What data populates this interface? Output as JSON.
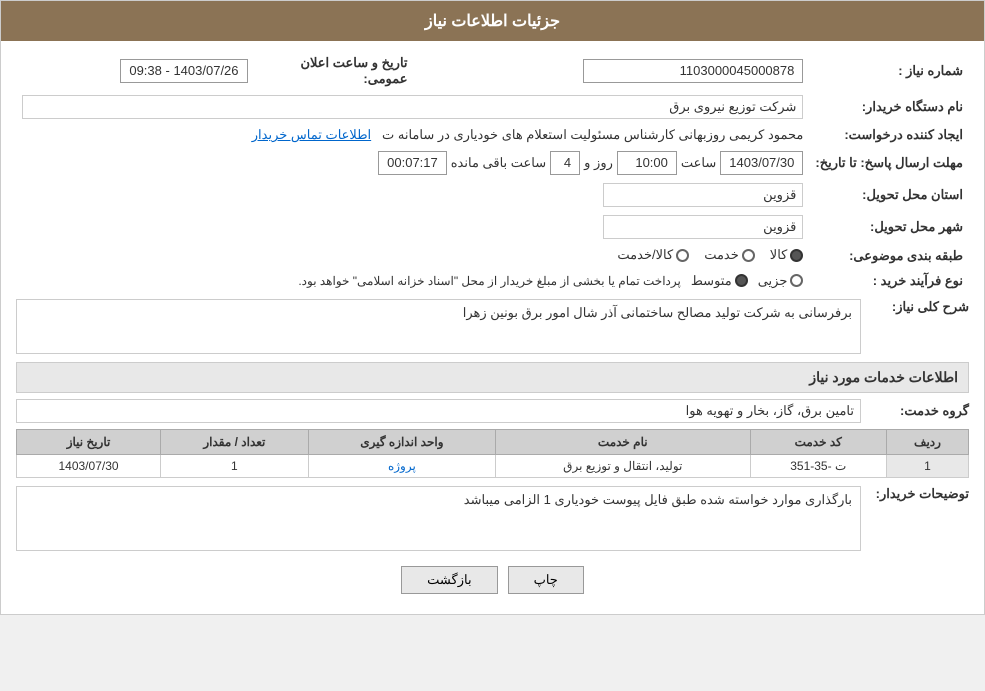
{
  "header": {
    "title": "جزئیات اطلاعات نیاز"
  },
  "fields": {
    "need_number_label": "شماره نیاز :",
    "need_number_value": "1103000045000878",
    "buyer_org_label": "نام دستگاه خریدار:",
    "buyer_org_value": "شرکت توزیع نیروی برق",
    "creator_label": "ایجاد کننده درخواست:",
    "creator_value": "محمود کریمی روزبهانی کارشناس  مسئولیت استعلام های خودیاری در سامانه ت",
    "creator_link": "اطلاعات تماس خریدار",
    "deadline_label": "مهلت ارسال پاسخ: تا تاریخ:",
    "deadline_date": "1403/07/30",
    "deadline_time_label": "ساعت",
    "deadline_time": "10:00",
    "deadline_day_label": "روز و",
    "deadline_days": "4",
    "deadline_remaining_label": "ساعت باقی مانده",
    "deadline_remaining": "00:07:17",
    "announce_label": "تاریخ و ساعت اعلان عمومی:",
    "announce_value": "1403/07/26 - 09:38",
    "province_label": "استان محل تحویل:",
    "province_value": "قزوین",
    "city_label": "شهر محل تحویل:",
    "city_value": "قزوین",
    "category_label": "طبقه بندی موضوعی:",
    "category_options": [
      "کالا",
      "خدمت",
      "کالا/خدمت"
    ],
    "category_selected": "کالا",
    "procurement_label": "نوع فرآیند خرید :",
    "procurement_options": [
      "جزیی",
      "متوسط"
    ],
    "procurement_selected": "متوسط",
    "procurement_note": "پرداخت تمام یا بخشی از مبلغ خریدار از محل \"اسناد خزانه اسلامی\" خواهد بود.",
    "need_desc_label": "شرح کلی نیاز:",
    "need_desc_value": "برفرسانی به شرکت تولید مصالح ساختمانی آذر شال امور برق بونین زهرا",
    "services_section_label": "اطلاعات خدمات مورد نیاز",
    "service_group_label": "گروه خدمت:",
    "service_group_value": "تامین برق، گاز، بخار و تهویه هوا",
    "table_headers": [
      "ردیف",
      "کد خدمت",
      "نام خدمت",
      "واحد اندازه گیری",
      "تعداد / مقدار",
      "تاریخ نیاز"
    ],
    "table_rows": [
      {
        "row": "1",
        "code": "ت -35-351",
        "name": "تولید، انتقال و توزیع برق",
        "unit": "پروژه",
        "quantity": "1",
        "date": "1403/07/30"
      }
    ],
    "buyer_notes_label": "توضیحات خریدار:",
    "buyer_notes_value": "بارگذاری موارد خواسته شده طبق فایل پیوست خودیاری 1 الزامی میباشد"
  },
  "buttons": {
    "print": "چاپ",
    "back": "بازگشت"
  }
}
